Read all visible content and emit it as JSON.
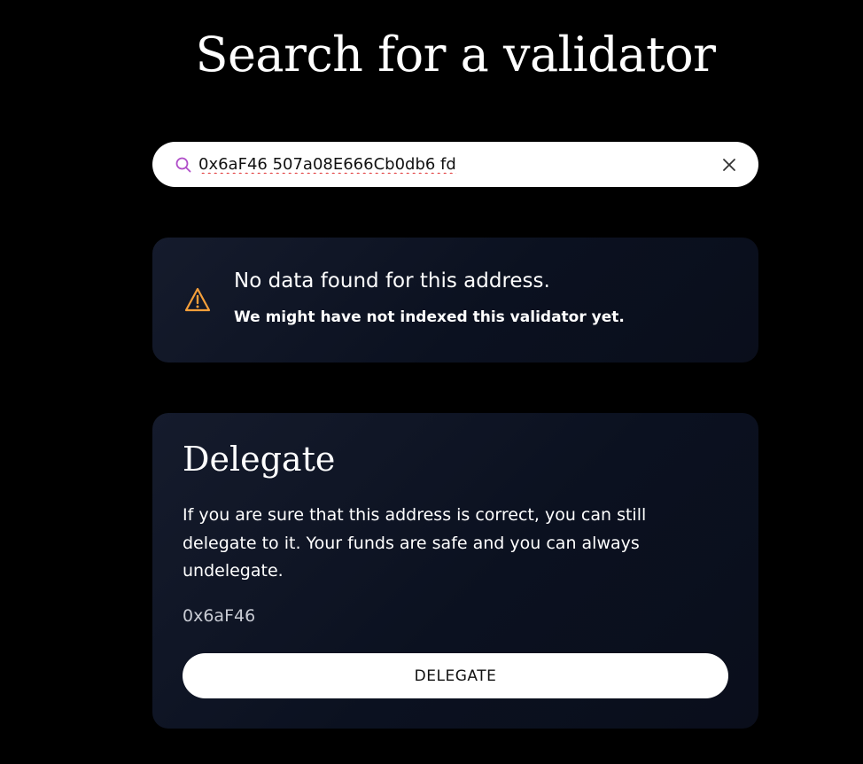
{
  "header": {
    "title": "Search for a validator"
  },
  "search": {
    "value": "0x6aF46 507a08E666Cb0db6 fd",
    "icon": "search-icon",
    "clear_icon": "close-icon"
  },
  "notice": {
    "icon": "warning-icon",
    "title": "No data found for this address.",
    "subtitle": "We might have not indexed this validator yet."
  },
  "delegate": {
    "title": "Delegate",
    "description": "If you are sure that this address is correct, you can still delegate to it. Your funds are safe and you can always undelegate.",
    "address": "0x6aF46",
    "button_label": "DELEGATE"
  },
  "colors": {
    "background": "#000000",
    "card": "#0b1120",
    "warning": "#f59f3a",
    "search_icon": "#b04ec9"
  }
}
